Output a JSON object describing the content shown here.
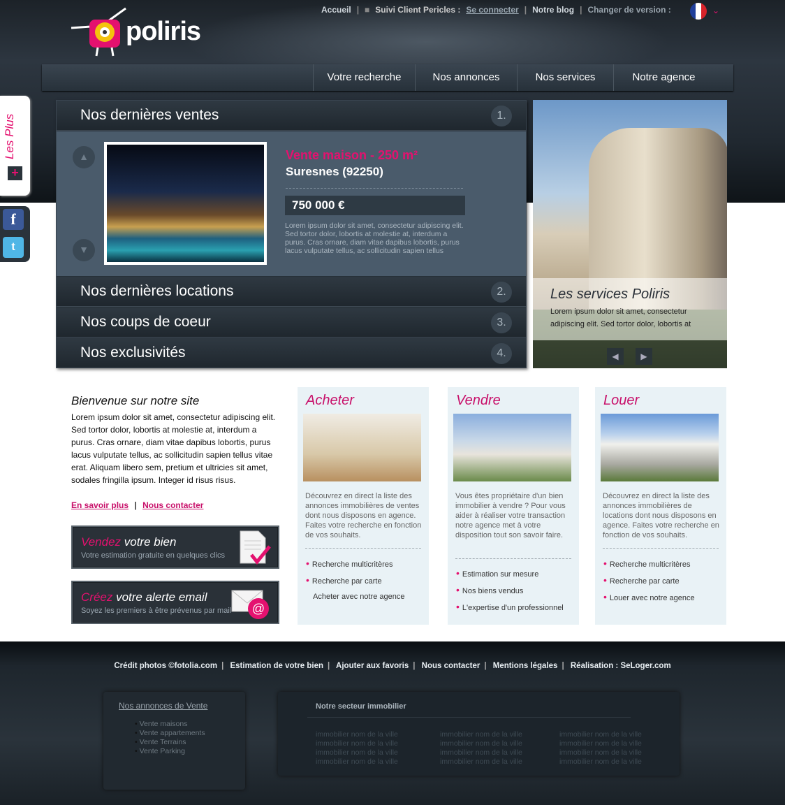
{
  "header": {
    "logo_text": "poliris",
    "links": {
      "home": "Accueil",
      "client_label": "Suivi Client Pericles :",
      "login": "Se connecter",
      "blog": "Notre blog",
      "version": "Changer de version :"
    }
  },
  "nav": [
    "Votre recherche",
    "Nos annonces",
    "Nos services",
    "Notre agence"
  ],
  "side": {
    "les_plus": "Les Plus",
    "plus_sign": "+"
  },
  "accordion": {
    "sections": [
      {
        "title": "Nos dernières ventes",
        "num": "1."
      },
      {
        "title": "Nos dernières locations",
        "num": "2."
      },
      {
        "title": "Nos coups de coeur",
        "num": "3."
      },
      {
        "title": "Nos exclusivités",
        "num": "4."
      }
    ],
    "listing": {
      "title": "Vente maison - 250 m²",
      "city": "Suresnes (92250)",
      "price": "750 000 €",
      "desc": "Lorem ipsum dolor sit amet, consectetur adipiscing elit. Sed tortor dolor, lobortis at molestie at, interdum a purus. Cras ornare, diam vitae dapibus lobortis, purus lacus vulputate tellus, ac sollicitudin sapien tellus"
    }
  },
  "services": {
    "title": "Les services Poliris",
    "text": "Lorem ipsum dolor sit amet, consectetur adipiscing elit. Sed tortor dolor, lobortis at"
  },
  "welcome": {
    "title": "Bienvenue sur notre site",
    "text": "Lorem ipsum dolor sit amet, consectetur adipiscing elit. Sed tortor dolor, lobortis at molestie at, interdum a purus. Cras ornare, diam vitae dapibus lobortis, purus lacus vulputate tellus, ac sollicitudin sapien tellus vitae erat. Aliquam libero sem, pretium et ultricies sit amet, sodales fringilla ipsum. Integer id risus risus.",
    "more": "En savoir plus",
    "contact": "Nous contacter",
    "sep": "|"
  },
  "cta": [
    {
      "em": "Vendez",
      "rest": " votre bien",
      "sub": "Votre estimation gratuite en quelques clics"
    },
    {
      "em": "Créez",
      "rest": " votre alerte email",
      "sub": "Soyez les premiers à être prévenus par mail"
    }
  ],
  "columns": [
    {
      "title": "Acheter",
      "desc": "Découvrez en direct la liste des annonces immobilières de ventes dont nous disposons en agence. Faites votre recherche en fonction de vos souhaits.",
      "items": [
        "Recherche multicritères",
        "Recherche par carte",
        "Acheter avec notre agence"
      ]
    },
    {
      "title": "Vendre",
      "desc": "Vous êtes propriétaire d'un bien immobilier à vendre ? Pour vous aider à réaliser votre transaction notre agence met à votre disposition tout son savoir faire.",
      "items": [
        "Estimation sur mesure",
        "Nos biens vendus",
        "L'expertise d'un professionnel"
      ]
    },
    {
      "title": "Louer",
      "desc": "Découvrez en direct la liste des annonces immobilières de locations dont nous disposons en agence. Faites votre recherche en fonction de vos souhaits.",
      "items": [
        "Recherche multicritères",
        "Recherche par carte",
        "Louer avec notre agence"
      ]
    }
  ],
  "footer": {
    "links": [
      "Crédit photos ©fotolia.com",
      "Estimation de votre bien",
      "Ajouter aux favoris",
      "Nous contacter",
      "Mentions légales",
      "Réalisation : SeLoger.com"
    ],
    "box1_title": "Nos annonces de Vente",
    "box1_items": [
      "Vente maisons",
      "Vente appartements",
      "Vente Terrains",
      "Vente Parking"
    ],
    "box2_title": "Notre secteur immobilier",
    "city_item": "immobilier nom de la ville"
  },
  "colors": {
    "accent": "#e4116f",
    "dark": "#263038"
  }
}
